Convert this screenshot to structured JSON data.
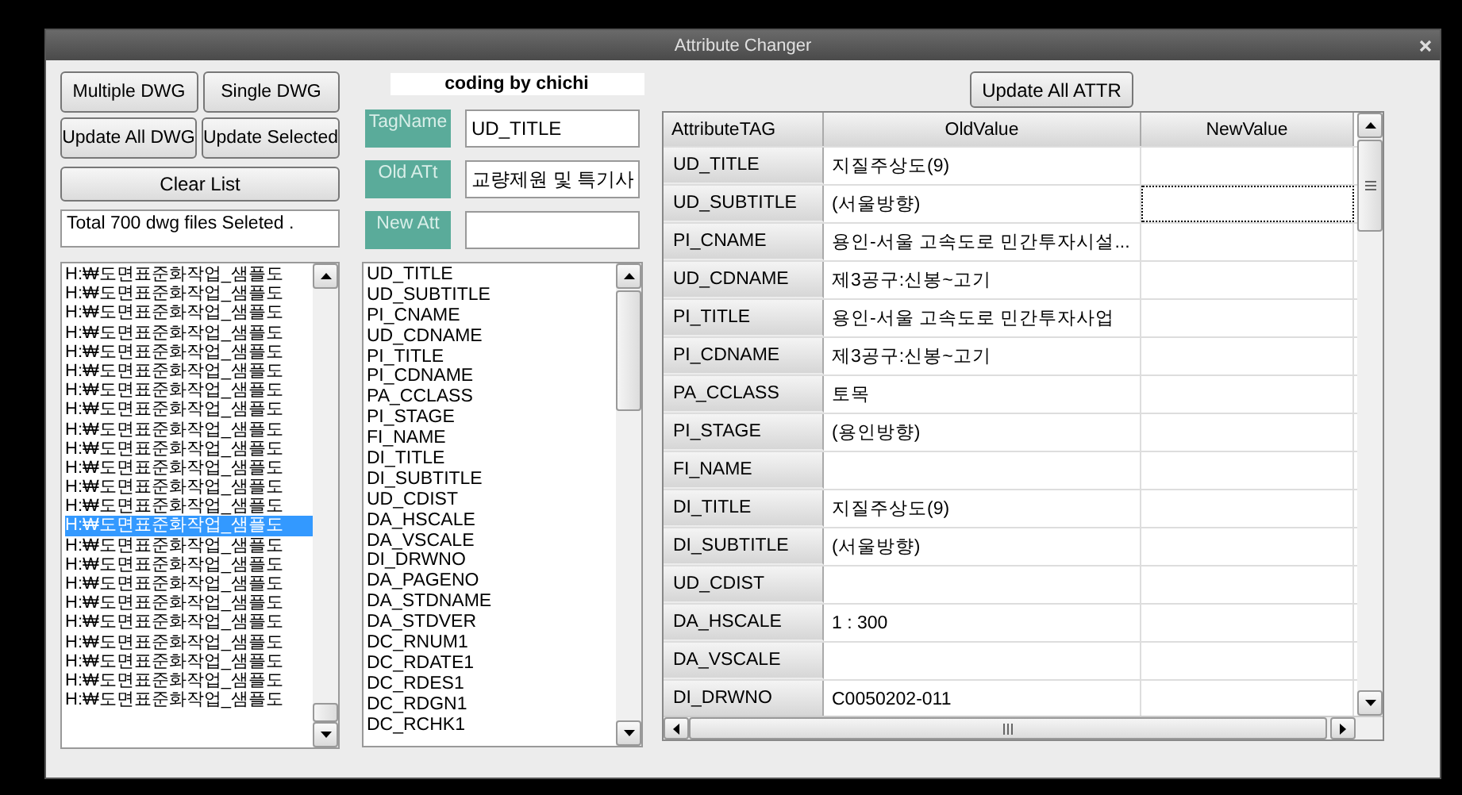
{
  "window": {
    "title": "Attribute Changer"
  },
  "buttons": {
    "multiple": "Multiple DWG",
    "single": "Single DWG",
    "update_all_dwg": "Update All DWG",
    "update_selected": "Update Selected",
    "clear_list": "Clear List"
  },
  "status": "Total  700 dwg files Seleted .",
  "files": [
    {
      "path": "H:₩도면표준화작업_샘플도",
      "selected": false
    },
    {
      "path": "H:₩도면표준화작업_샘플도",
      "selected": false
    },
    {
      "path": "H:₩도면표준화작업_샘플도",
      "selected": false
    },
    {
      "path": "H:₩도면표준화작업_샘플도",
      "selected": false
    },
    {
      "path": "H:₩도면표준화작업_샘플도",
      "selected": false
    },
    {
      "path": "H:₩도면표준화작업_샘플도",
      "selected": false
    },
    {
      "path": "H:₩도면표준화작업_샘플도",
      "selected": false
    },
    {
      "path": "H:₩도면표준화작업_샘플도",
      "selected": false
    },
    {
      "path": "H:₩도면표준화작업_샘플도",
      "selected": false
    },
    {
      "path": "H:₩도면표준화작업_샘플도",
      "selected": false
    },
    {
      "path": "H:₩도면표준화작업_샘플도",
      "selected": false
    },
    {
      "path": "H:₩도면표준화작업_샘플도",
      "selected": false
    },
    {
      "path": "H:₩도면표준화작업_샘플도",
      "selected": false
    },
    {
      "path": "H:₩도면표준화작업_샘플도",
      "selected": true
    },
    {
      "path": "H:₩도면표준화작업_샘플도",
      "selected": false
    },
    {
      "path": "H:₩도면표준화작업_샘플도",
      "selected": false
    },
    {
      "path": "H:₩도면표준화작업_샘플도",
      "selected": false
    },
    {
      "path": "H:₩도면표준화작업_샘플도",
      "selected": false
    },
    {
      "path": "H:₩도면표준화작업_샘플도",
      "selected": false
    },
    {
      "path": "H:₩도면표준화작업_샘플도",
      "selected": false
    },
    {
      "path": "H:₩도면표준화작업_샘플도",
      "selected": false
    },
    {
      "path": "H:₩도면표준화작업_샘플도",
      "selected": false
    },
    {
      "path": "H:₩도면표준화작업_샘플도",
      "selected": false
    }
  ],
  "credit": "coding by chichi",
  "fields": [
    {
      "label": "TagName",
      "value": "UD_TITLE"
    },
    {
      "label": "Old ATt",
      "value": "교량제원 및 특기사"
    },
    {
      "label": "New Att"
    }
  ],
  "tags": [
    "UD_TITLE",
    "UD_SUBTITLE",
    "PI_CNAME",
    "UD_CDNAME",
    "PI_TITLE",
    "PI_CDNAME",
    "PA_CCLASS",
    "PI_STAGE",
    "FI_NAME",
    "DI_TITLE",
    "DI_SUBTITLE",
    "UD_CDIST",
    "DA_HSCALE",
    "DA_VSCALE",
    "DI_DRWNO",
    "DA_PAGENO",
    "DA_STDNAME",
    "DA_STDVER",
    "DC_RNUM1",
    "DC_RDATE1",
    "DC_RDES1",
    "DC_RDGN1",
    "DC_RCHK1"
  ],
  "update_all_attr": "Update All ATTR",
  "grid": {
    "columns": [
      "AttributeTAG",
      "OldValue",
      "NewValue"
    ],
    "rows": [
      {
        "tag": "UD_TITLE",
        "old": "지질주상도(9)",
        "focused": false
      },
      {
        "tag": "UD_SUBTITLE",
        "old": "(서울방향)",
        "focused": true
      },
      {
        "tag": "PI_CNAME",
        "old": "용인-서울 고속도로 민간투자시설...",
        "focused": false
      },
      {
        "tag": "UD_CDNAME",
        "old": "제3공구:신봉~고기",
        "focused": false
      },
      {
        "tag": "PI_TITLE",
        "old": "용인-서울 고속도로 민간투자사업",
        "focused": false
      },
      {
        "tag": "PI_CDNAME",
        "old": "제3공구:신봉~고기",
        "focused": false
      },
      {
        "tag": "PA_CCLASS",
        "old": "토목",
        "focused": false
      },
      {
        "tag": "PI_STAGE",
        "old": "(용인방향)",
        "focused": false
      },
      {
        "tag": "FI_NAME",
        "focused": false
      },
      {
        "tag": "DI_TITLE",
        "old": "지질주상도(9)",
        "focused": false
      },
      {
        "tag": "DI_SUBTITLE",
        "old": "(서울방향)",
        "focused": false
      },
      {
        "tag": "UD_CDIST",
        "focused": false
      },
      {
        "tag": "DA_HSCALE",
        "old": "1 : 300",
        "focused": false
      },
      {
        "tag": "DA_VSCALE",
        "focused": false
      },
      {
        "tag": "DI_DRWNO",
        "old": "C0050202-011",
        "focused": false
      }
    ]
  }
}
